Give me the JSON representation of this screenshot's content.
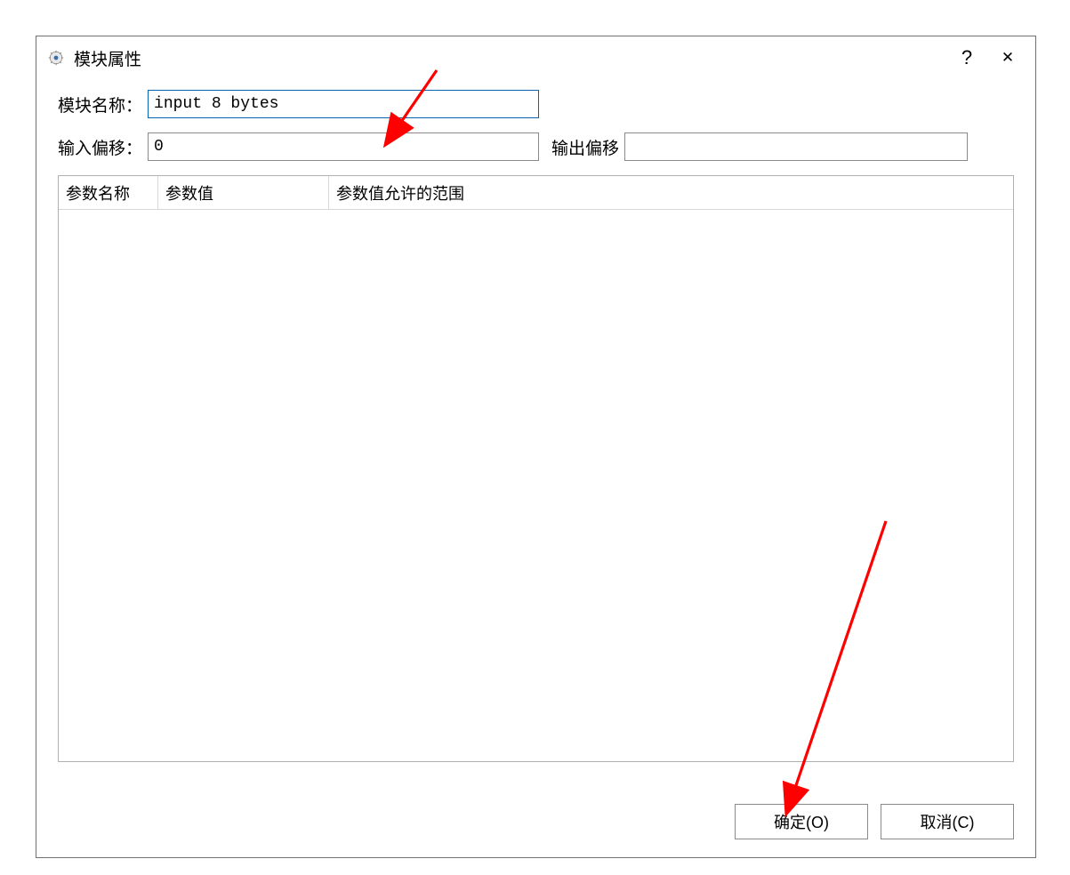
{
  "dialog": {
    "title": "模块属性",
    "help_symbol": "?",
    "close_symbol": "✕"
  },
  "form": {
    "module_name_label": "模块名称：",
    "module_name_value": "input 8 bytes",
    "input_offset_label": "输入偏移：",
    "input_offset_value": "0",
    "output_offset_label": "输出偏移",
    "output_offset_value": ""
  },
  "table": {
    "headers": {
      "col1": "参数名称",
      "col2": "参数值",
      "col3": "参数值允许的范围"
    },
    "rows": []
  },
  "buttons": {
    "ok": "确定(O)",
    "cancel": "取消(C)"
  },
  "annotations": {
    "arrow_color": "#ff0000"
  }
}
